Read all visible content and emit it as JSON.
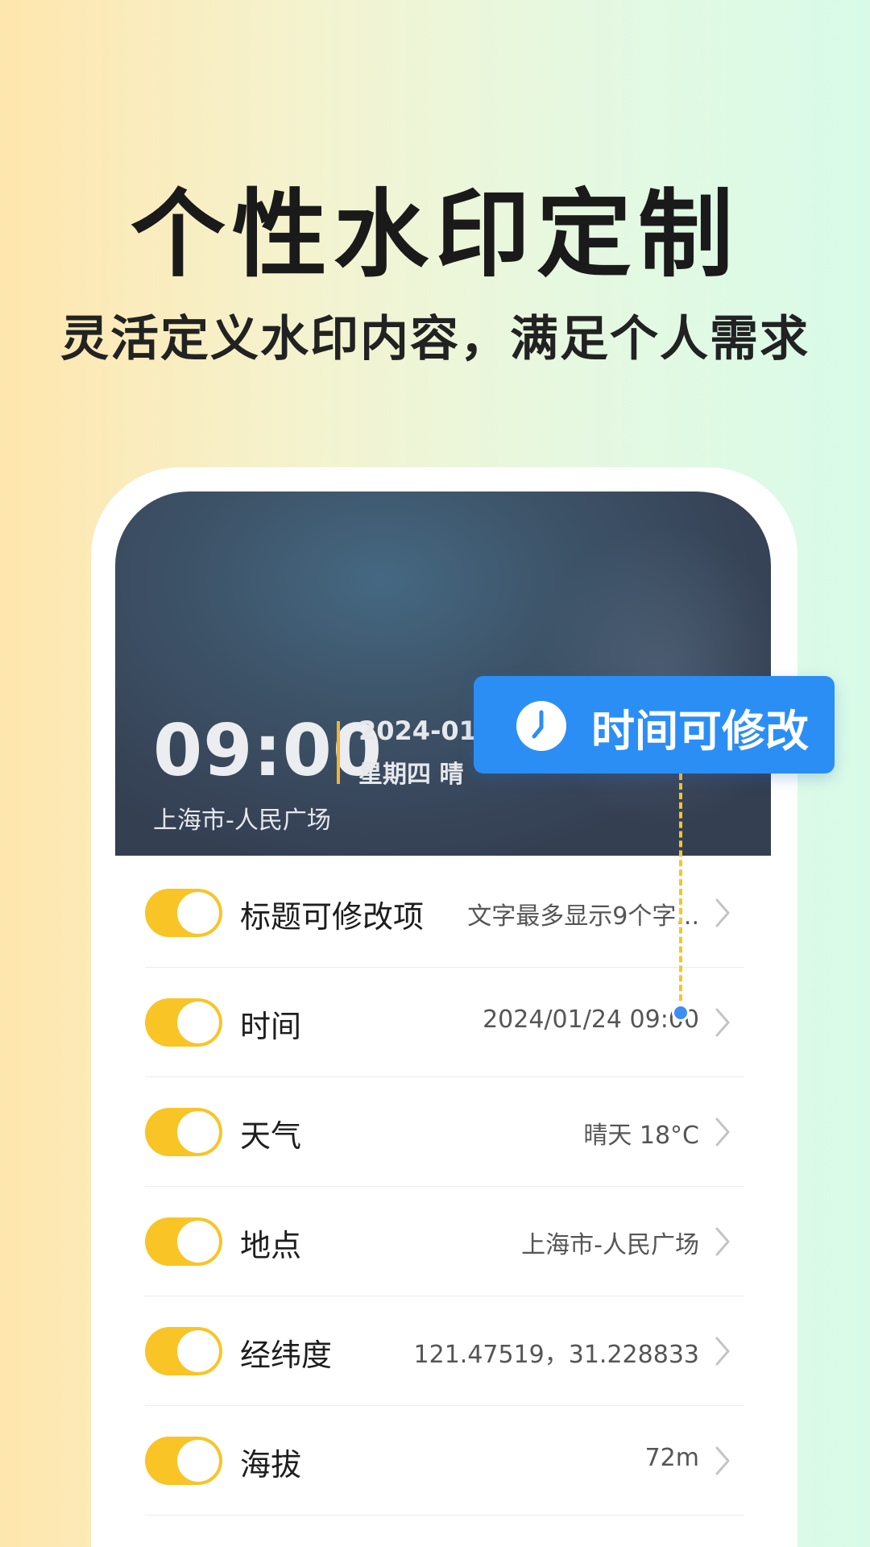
{
  "promo": {
    "headline": "个性水印定制",
    "subhead": "灵活定义水印内容，满足个人需求"
  },
  "watermark": {
    "time": "09:00",
    "date": "2024-01-2",
    "day_weather": "星期四 晴",
    "location": "上海市-人民广场"
  },
  "tooltip": {
    "icon": "clock-icon",
    "text": "时间可修改",
    "color": "#2b8ef5"
  },
  "colors": {
    "toggle_on": "#f9c425",
    "divider_accent": "#f2b33a"
  },
  "settings": {
    "rows": [
      {
        "label": "标题可修改项",
        "value": "文字最多显示9个字...",
        "enabled": true
      },
      {
        "label": "时间",
        "value": "2024/01/24  09:00",
        "enabled": true
      },
      {
        "label": "天气",
        "value": "晴天 18°C",
        "enabled": true
      },
      {
        "label": "地点",
        "value": "上海市-人民广场",
        "enabled": true
      },
      {
        "label": "经纬度",
        "value": "121.47519，31.228833",
        "enabled": true
      },
      {
        "label": "海拔",
        "value": "72m",
        "enabled": true
      }
    ]
  }
}
